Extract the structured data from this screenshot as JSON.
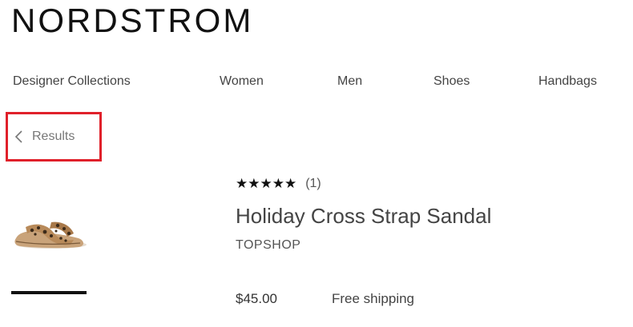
{
  "header": {
    "logo_text": "NORDSTROM"
  },
  "nav": {
    "items": [
      {
        "label": "Designer Collections"
      },
      {
        "label": "Women"
      },
      {
        "label": "Men"
      },
      {
        "label": "Shoes"
      },
      {
        "label": "Handbags"
      }
    ]
  },
  "breadcrumb": {
    "back_label": "Results",
    "back_icon": "chevron-left-icon",
    "highlight_color": "#e0202a"
  },
  "product": {
    "thumbnail_alt": "leopard print cross strap sandal",
    "rating_stars": "★★★★★",
    "rating_value": 5,
    "review_count": "(1)",
    "title": "Holiday Cross Strap Sandal",
    "brand": "TOPSHOP",
    "price": "$45.00",
    "shipping": "Free shipping"
  }
}
